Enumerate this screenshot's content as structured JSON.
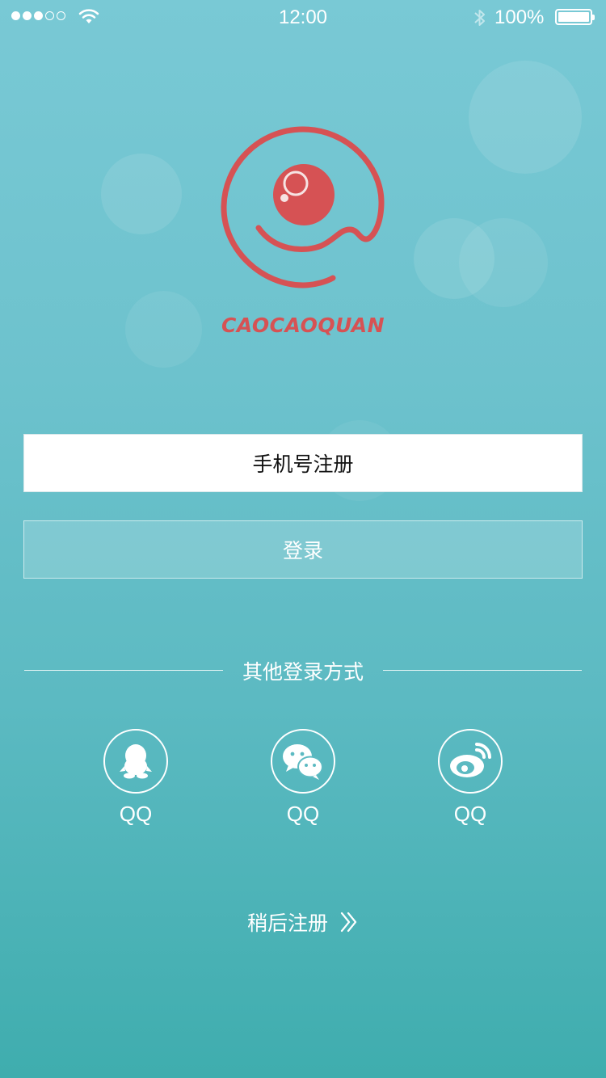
{
  "status_bar": {
    "time": "12:00",
    "battery": "100%",
    "signal_icon": "signal-dots-icon",
    "wifi_icon": "wifi-icon",
    "bluetooth_icon": "bluetooth-icon",
    "battery_icon": "battery-icon"
  },
  "brand": {
    "name": "CAOCAOQUAN",
    "logo_icon": "eye-spiral-logo",
    "color": "#d65254"
  },
  "buttons": {
    "register": "手机号注册",
    "login": "登录"
  },
  "other_login": {
    "title": "其他登录方式",
    "options": [
      {
        "label": "QQ",
        "icon": "qq-penguin-icon"
      },
      {
        "label": "QQ",
        "icon": "wechat-icon"
      },
      {
        "label": "QQ",
        "icon": "weibo-icon"
      }
    ]
  },
  "later": {
    "label": "稍后注册",
    "icon": "double-chevron-right-icon"
  },
  "colors": {
    "background_top": "#79c9d5",
    "background_bottom": "#3fadae",
    "accent": "#d65254"
  }
}
